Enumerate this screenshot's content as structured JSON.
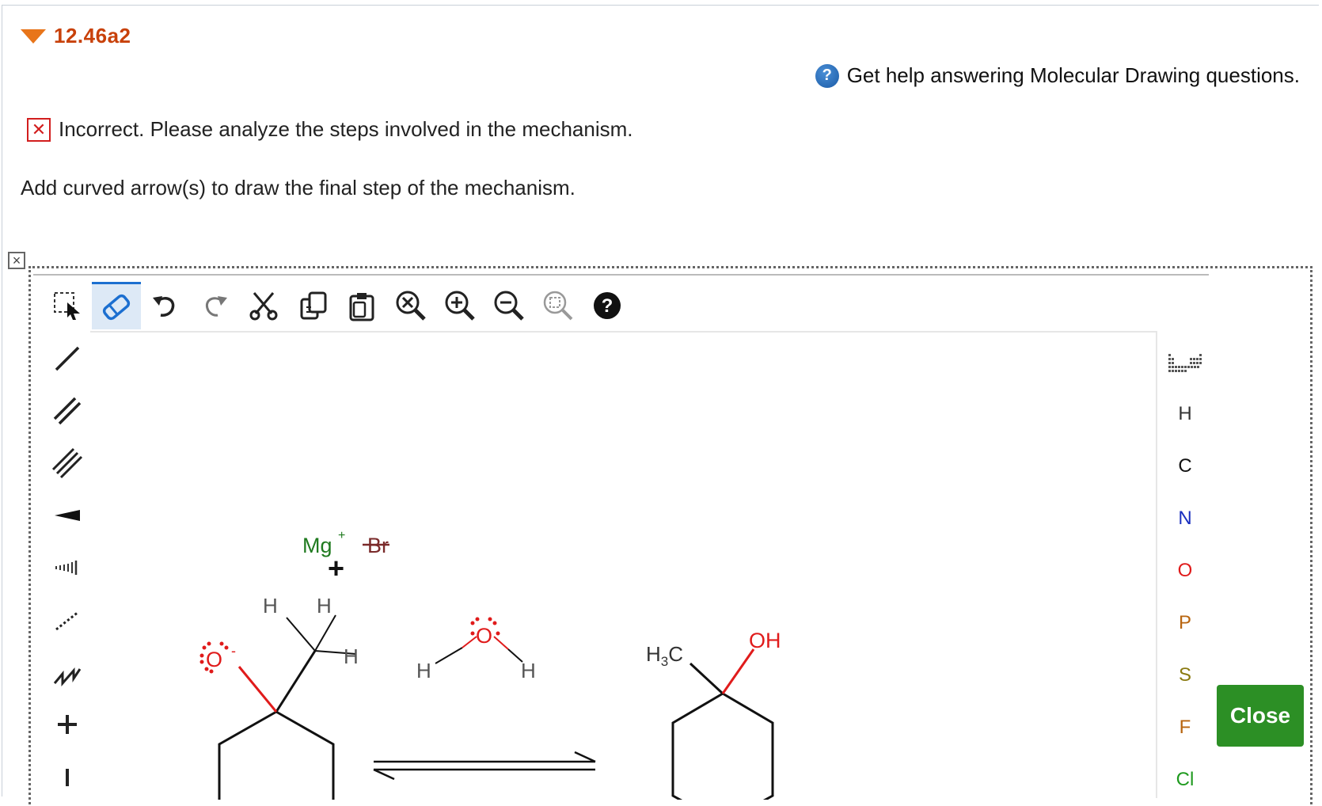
{
  "question": {
    "number": "12.46a2"
  },
  "help": {
    "icon": "question-circle-icon",
    "text": "Get help answering Molecular Drawing questions."
  },
  "feedback": {
    "icon": "x-box-icon",
    "text": "Incorrect. Please analyze the steps involved in the mechanism."
  },
  "prompt": "Add curved arrow(s) to draw the final step of the mechanism.",
  "toolbar": {
    "tools": [
      "select-icon",
      "eraser-icon",
      "undo-icon",
      "redo-icon",
      "cut-icon",
      "copy-icon",
      "paste-icon",
      "zoom-reset-icon",
      "zoom-in-icon",
      "zoom-out-icon",
      "zoom-fit-icon",
      "help-icon"
    ],
    "active": "eraser-icon"
  },
  "left_tools": [
    "single-bond-icon",
    "double-bond-icon",
    "triple-bond-icon",
    "wedge-bond-icon",
    "hash-bond-icon",
    "dashed-bond-icon",
    "chain-icon",
    "positive-charge-icon",
    "negative-charge-icon"
  ],
  "elements": {
    "periodic_icon": "periodic-table-icon",
    "list": [
      {
        "symbol": "H",
        "color": "#333333"
      },
      {
        "symbol": "C",
        "color": "#111111"
      },
      {
        "symbol": "N",
        "color": "#1a2fbf"
      },
      {
        "symbol": "O",
        "color": "#e01b1b"
      },
      {
        "symbol": "P",
        "color": "#b8650f"
      },
      {
        "symbol": "S",
        "color": "#8a7a10"
      },
      {
        "symbol": "F",
        "color": "#b8650f"
      },
      {
        "symbol": "Cl",
        "color": "#1f9a1f"
      }
    ]
  },
  "close_button": {
    "label": "Close",
    "color": "#2c8f25"
  },
  "molecules": {
    "reactant": {
      "mg": "Mg",
      "mg_charge": "+",
      "br": "Br",
      "plus": "+",
      "h1": "H",
      "h2": "H",
      "h3": "H",
      "o": "O",
      "o_charge": "-"
    },
    "water": {
      "o": "O",
      "h_left": "H",
      "h_right": "H"
    },
    "product": {
      "h3c_h": "H",
      "h3c_sub": "3",
      "h3c_c": "C",
      "oh": "OH"
    }
  },
  "colors": {
    "accent": "#e8751a",
    "question": "#c8410a",
    "error": "#d21e1e",
    "oxygen": "#e01b1b",
    "magnesium": "#1f7a1f",
    "bromine": "#7a2a2a"
  }
}
